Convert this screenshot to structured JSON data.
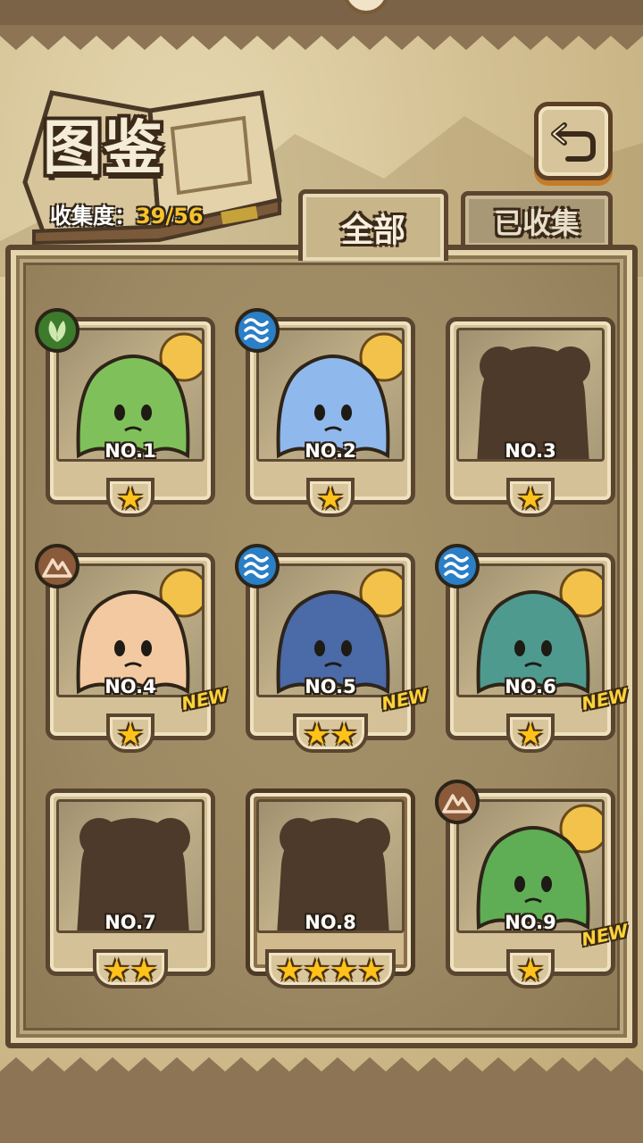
{
  "header": {
    "title": "图鉴",
    "collection_label": "收集度：",
    "collection_value": "39/56"
  },
  "tabs": [
    {
      "label": "全部",
      "active": true
    },
    {
      "label": "已收集",
      "active": false
    }
  ],
  "colors": {
    "gold": "#f6c22c",
    "frame": "#5c4630",
    "parchment": "#d4c198",
    "grass": "#3c7a2c",
    "water": "#2a7fc6",
    "earth": "#8a5a3a"
  },
  "cards": [
    {
      "number": "NO.1",
      "element": "grass-icon",
      "stars": "★",
      "new": "",
      "locked": false,
      "color": "#7fc05a"
    },
    {
      "number": "NO.2",
      "element": "water-icon",
      "stars": "★",
      "new": "",
      "locked": false,
      "color": "#8fb8ec"
    },
    {
      "number": "NO.3",
      "element": "",
      "stars": "★",
      "new": "",
      "locked": true,
      "color": "#4d3a2a"
    },
    {
      "number": "NO.4",
      "element": "earth-icon",
      "stars": "★",
      "new": "NEW",
      "locked": false,
      "color": "#f2c9a0"
    },
    {
      "number": "NO.5",
      "element": "water-icon",
      "stars": "★★",
      "new": "NEW",
      "locked": false,
      "color": "#4a6aa8"
    },
    {
      "number": "NO.6",
      "element": "water-icon",
      "stars": "★",
      "new": "NEW",
      "locked": false,
      "color": "#4f9a8e"
    },
    {
      "number": "NO.7",
      "element": "",
      "stars": "★★",
      "new": "",
      "locked": true,
      "color": "#4d3a2a"
    },
    {
      "number": "NO.8",
      "element": "",
      "stars": "★★★★",
      "new": "",
      "locked": true,
      "color": "#4d3a2a"
    },
    {
      "number": "NO.9",
      "element": "earth-icon",
      "stars": "★",
      "new": "NEW",
      "locked": false,
      "color": "#5fae55"
    }
  ]
}
